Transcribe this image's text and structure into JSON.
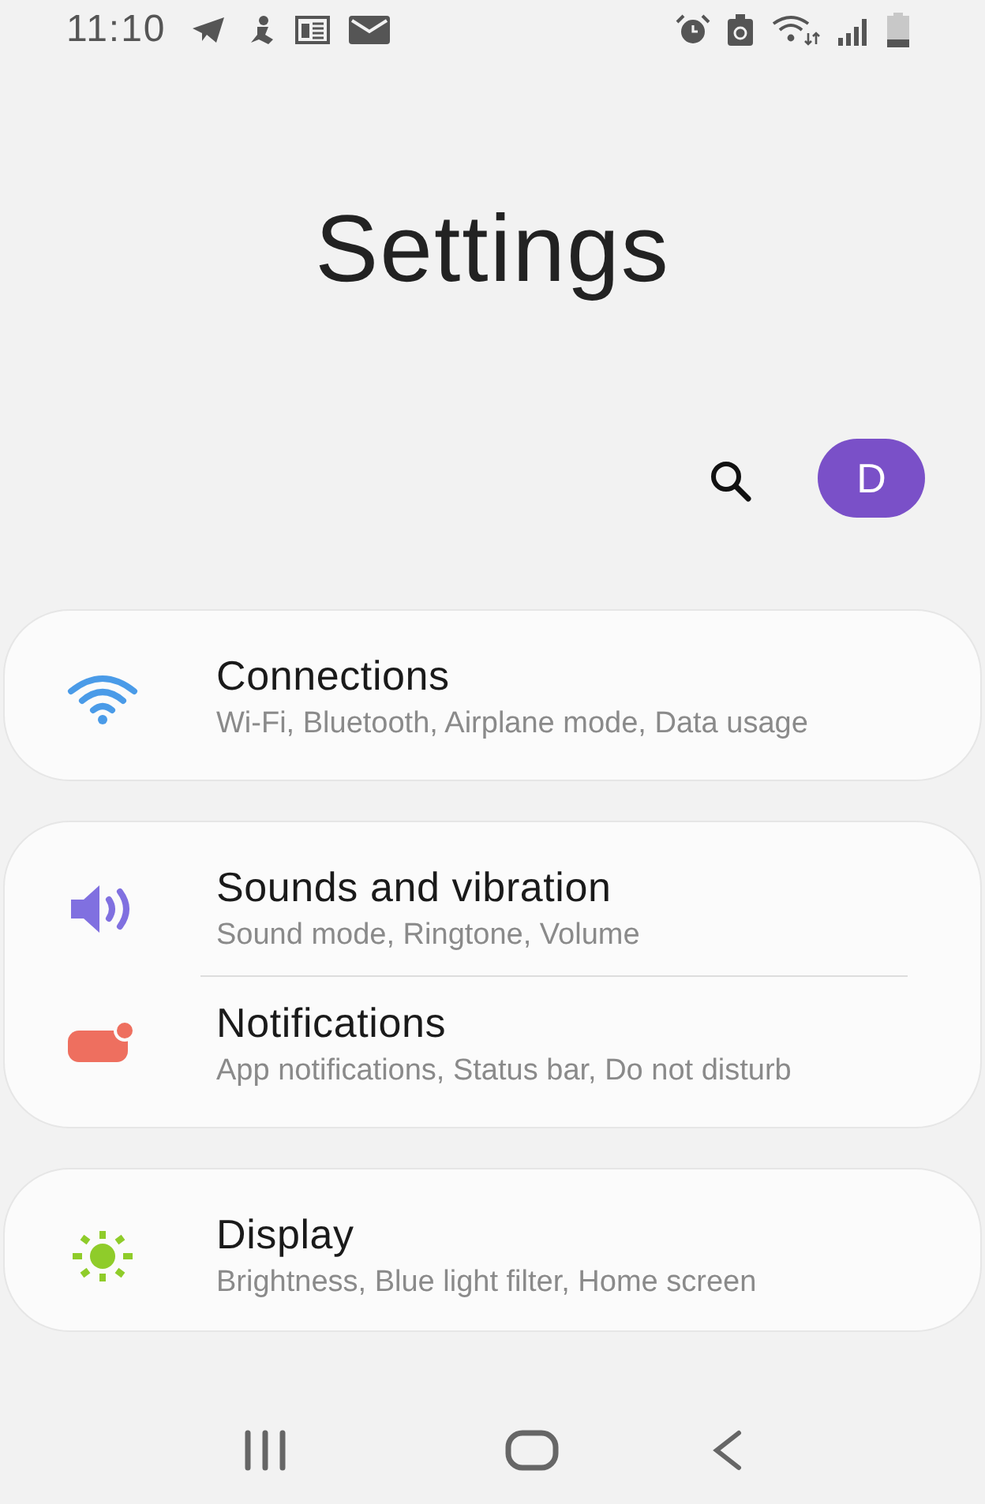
{
  "status_bar": {
    "time": "11:10"
  },
  "title": "Settings",
  "profile": {
    "initial": "D"
  },
  "groups": [
    {
      "items": [
        {
          "kind": "wifi",
          "color": "#4a9be8",
          "title": "Connections",
          "subtitle": "Wi-Fi, Bluetooth, Airplane mode, Data usage"
        }
      ]
    },
    {
      "items": [
        {
          "kind": "sound",
          "color": "#8070e0",
          "title": "Sounds and vibration",
          "subtitle": "Sound mode, Ringtone, Volume"
        },
        {
          "kind": "notification",
          "color": "#ee6f5f",
          "title": "Notifications",
          "subtitle": "App notifications, Status bar, Do not disturb"
        }
      ]
    },
    {
      "items": [
        {
          "kind": "display",
          "color": "#8fcc2a",
          "title": "Display",
          "subtitle": "Brightness, Blue light filter, Home screen"
        }
      ]
    }
  ]
}
